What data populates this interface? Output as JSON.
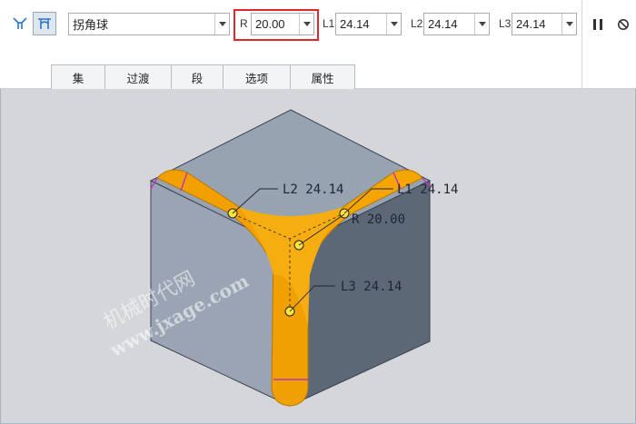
{
  "toolbar": {
    "type_combo": {
      "value": "拐角球",
      "icon": "chevron-down-icon"
    },
    "radius": {
      "label": "R",
      "value": "20.00"
    },
    "l1": {
      "label": "L1",
      "value": "24.14"
    },
    "l2": {
      "label": "L2",
      "value": "24.14"
    },
    "l3": {
      "label": "L3",
      "value": "24.14"
    },
    "icons": [
      "round-corner-icon",
      "corner-sphere-icon",
      "pause-icon",
      "cancel-icon"
    ]
  },
  "tabs": [
    {
      "label": "集"
    },
    {
      "label": "过渡"
    },
    {
      "label": "段"
    },
    {
      "label": "选项"
    },
    {
      "label": "属性"
    }
  ],
  "graphics": {
    "annotations": {
      "l2": "L2 24.14",
      "l1": "L1 24.14",
      "r": "R 20.00",
      "l3": "L3 24.14"
    },
    "watermark_line1": "机械时代网",
    "watermark_line2": "www.jxage.com",
    "colors": {
      "background": "#d4d6d9",
      "cube_top": "#98a3b2",
      "cube_left": "#9aa4b4",
      "cube_right": "#5d6876",
      "fillet": "#f2a000",
      "highlight": "#e3262b"
    }
  }
}
